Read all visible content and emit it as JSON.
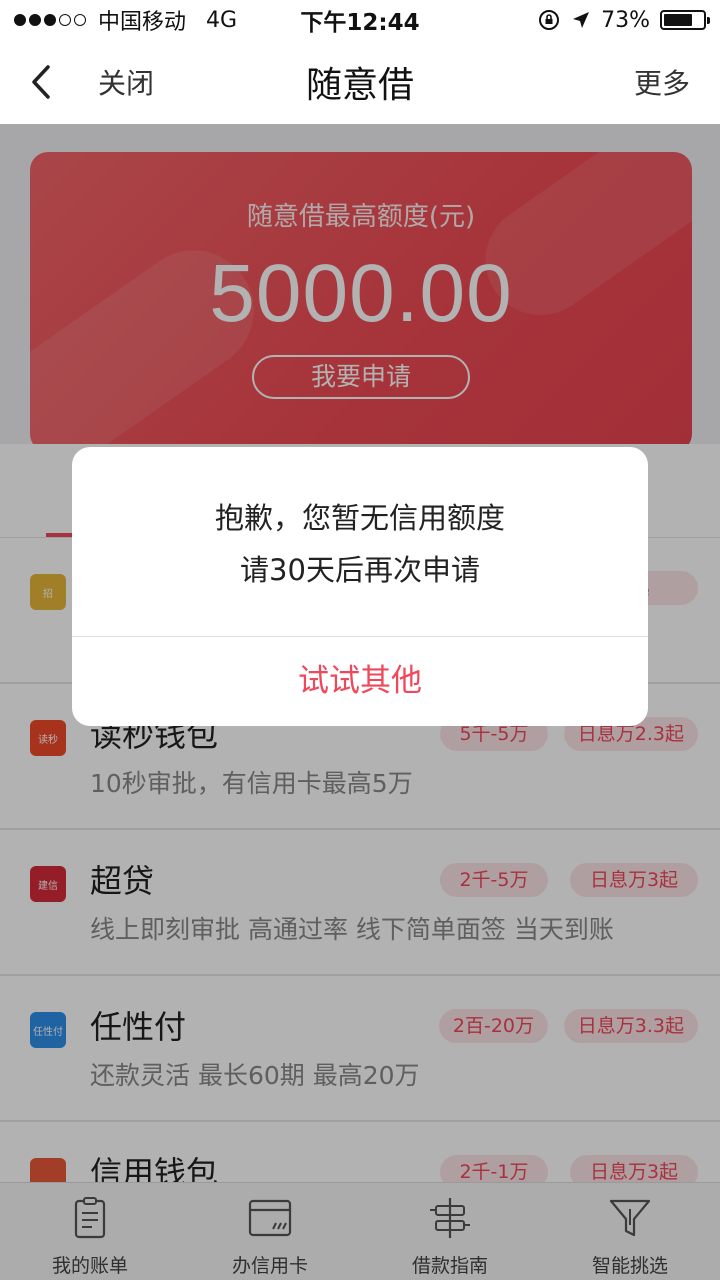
{
  "status": {
    "carrier": "中国移动",
    "network": "4G",
    "time": "下午12:44",
    "battery": "73%",
    "battery_level": 0.73
  },
  "nav": {
    "close_label": "关闭",
    "title": "随意借",
    "more_label": "更多"
  },
  "hero": {
    "label": "随意借最高额度(元)",
    "amount": "5000.00",
    "apply_label": "我要申请"
  },
  "list": [
    {
      "name": "",
      "desc": "",
      "range": "",
      "rate": "2起",
      "logo_text": "招",
      "logo_color": "#e7b73a"
    },
    {
      "name": "读秒钱包",
      "desc": "10秒审批，有信用卡最高5万",
      "range": "5千-5万",
      "rate": "日息万2.3起",
      "logo_text": "读秒",
      "logo_color": "#f04a2a"
    },
    {
      "name": "超贷",
      "desc": "线上即刻审批 高通过率 线下简单面签 当天到账",
      "range": "2千-5万",
      "rate": "日息万3起",
      "logo_text": "建信",
      "logo_color": "#d62a3a"
    },
    {
      "name": "任性付",
      "desc": "还款灵活 最长60期 最高20万",
      "range": "2百-20万",
      "rate": "日息万3.3起",
      "logo_text": "任性付",
      "logo_color": "#2d8fe8"
    },
    {
      "name": "信用钱包",
      "desc": "",
      "range": "2千-1万",
      "rate": "日息万3起",
      "logo_text": "",
      "logo_color": "#e85a3a"
    }
  ],
  "tabbar": {
    "items": [
      {
        "label": "我的账单",
        "icon": "bill-icon"
      },
      {
        "label": "办信用卡",
        "icon": "credit-card-icon"
      },
      {
        "label": "借款指南",
        "icon": "loan-guide-icon"
      },
      {
        "label": "智能挑选",
        "icon": "filter-icon"
      }
    ]
  },
  "dialog": {
    "line1": "抱歉，您暂无信用额度",
    "line2": "请30天后再次申请",
    "action_label": "试试其他"
  },
  "colors": {
    "accent": "#f0475a",
    "hero_red": "#ee4a53"
  }
}
